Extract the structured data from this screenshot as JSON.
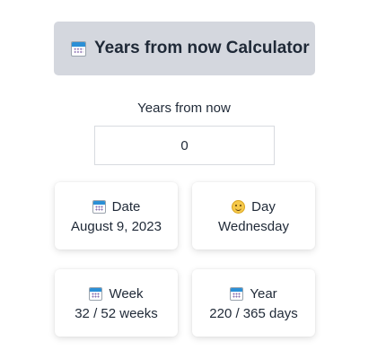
{
  "header": {
    "icon": "calendar-icon",
    "title": "Years from now Calculator"
  },
  "form": {
    "label": "Years from now",
    "value": "0"
  },
  "cards": {
    "date": {
      "icon": "calendar-icon",
      "label": "Date",
      "value": "August 9, 2023"
    },
    "day": {
      "icon": "smiling-face-icon",
      "label": "Day",
      "value": "Wednesday"
    },
    "week": {
      "icon": "calendar-icon",
      "label": "Week",
      "value": "32 / 52 weeks"
    },
    "year": {
      "icon": "calendar-icon",
      "label": "Year",
      "value": "220 / 365 days"
    }
  },
  "colors": {
    "header_bg": "#d4d7de",
    "text": "#1f2937",
    "input_border": "#d8dbe0",
    "calendar_accent": "#2b8fd6"
  }
}
